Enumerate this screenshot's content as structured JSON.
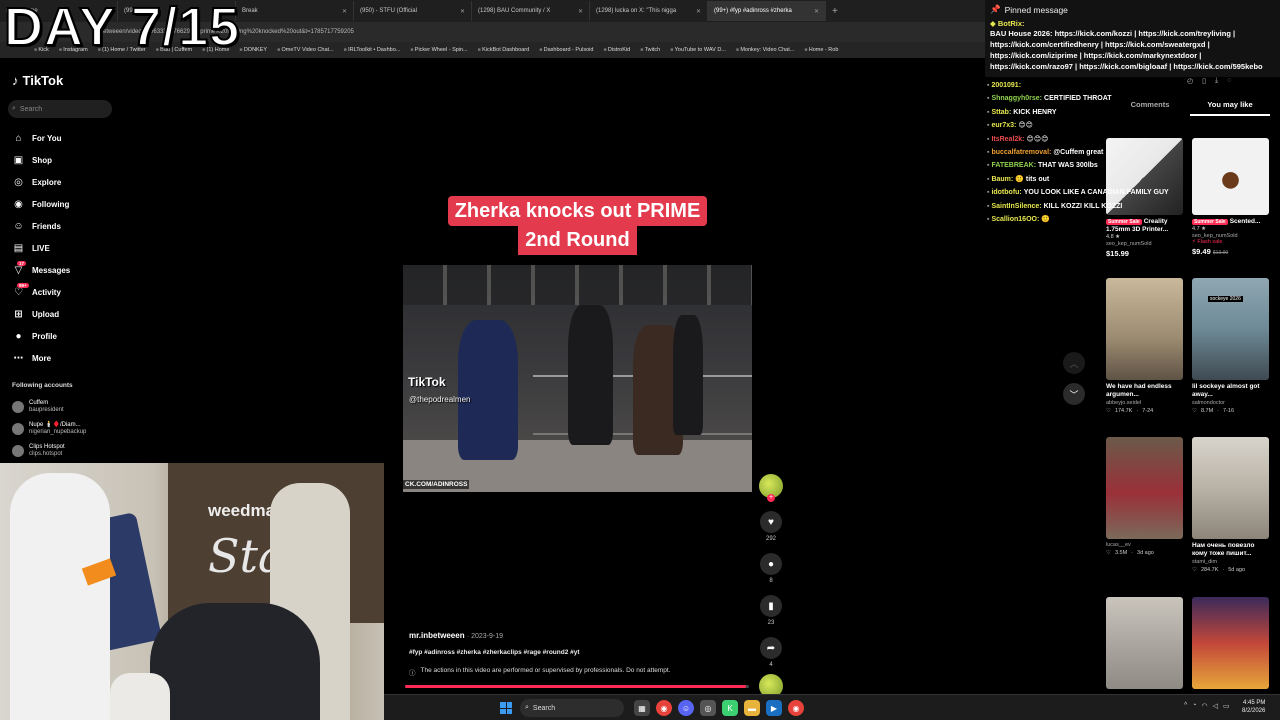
{
  "overlay": {
    "day": "DAY 7/15"
  },
  "browser": {
    "tabs": [
      {
        "label": "(272) Home"
      },
      {
        "label": "(99+)"
      },
      {
        "label": "Break"
      },
      {
        "label": "(950) - STFU (Official"
      },
      {
        "label": "(1298) BAU Community / X"
      },
      {
        "label": "(1298) lucka on X: \"This nigga"
      },
      {
        "label": "(99+) #fyp #adinross #zherka"
      }
    ],
    "url": "inbetweeen/video/73063337976629?q=prime%20fighting%20knocked%20out&t=1785717759205",
    "bookmarks": [
      "Kick",
      "Instagram",
      "(1) Home / Twitter",
      "Bau | Cuffem",
      "(1) Home",
      "DONKEY",
      "OmeTV Video Chat...",
      "IRLToolkit • Dashbo...",
      "Picker Wheel - Spin...",
      "KickBot Dashboard",
      "Dashboard - Pulsoid",
      "DistroKid",
      "Twitch",
      "YouTube to WAV D...",
      "Monkey: Video Chat...",
      "Home - Rob"
    ]
  },
  "tiktok": {
    "logo": "TikTok",
    "search_placeholder": "Search",
    "nav": [
      {
        "label": "For You",
        "icon": "home-icon"
      },
      {
        "label": "Shop",
        "icon": "shop-icon"
      },
      {
        "label": "Explore",
        "icon": "compass-icon"
      },
      {
        "label": "Following",
        "icon": "following-icon"
      },
      {
        "label": "Friends",
        "icon": "friends-icon"
      },
      {
        "label": "LIVE",
        "icon": "live-icon"
      },
      {
        "label": "Messages",
        "icon": "messages-icon",
        "badge": "17"
      },
      {
        "label": "Activity",
        "icon": "activity-icon",
        "badge": "99+"
      },
      {
        "label": "Upload",
        "icon": "upload-icon"
      },
      {
        "label": "Profile",
        "icon": "profile-icon"
      },
      {
        "label": "More",
        "icon": "more-icon"
      }
    ],
    "following_title": "Following accounts",
    "following": [
      {
        "name": "Cuffem",
        "handle": "baupresident"
      },
      {
        "name": "Nupe 🕯️♦️/Diam...",
        "handle": "nigerian_nupebackup"
      },
      {
        "name": "Clips Hotspot",
        "handle": "clips.hotspot"
      }
    ]
  },
  "webcam": {
    "sign_top": "weedmaps",
    "sign_main": "Sta"
  },
  "video": {
    "title_line1": "Zherka knocks out PRIME",
    "title_line2": "2nd Round",
    "watermark": "TikTok",
    "watermark_user": "@thepodrealmen",
    "url_overlay": "CK.COM/ADINROSS",
    "author": "mr.inbetweeen",
    "date": "2023-9-19",
    "hashtags": "#fyp #adinross #zherka #zherkaclips #rage #round2 #yt",
    "warning": "The actions in this video are performed or supervised by professionals. Do not attempt.",
    "progress": 0.99,
    "likes": "292",
    "comments": "8",
    "saves": "23",
    "shares": "4"
  },
  "chat": {
    "pinned_title": "Pinned message",
    "pinned_user": "BotRix:",
    "pinned_text": "BAU House 2026: https://kick.com/kozzi | https://kick.com/treyliving | https://kick.com/certifiedhenry | https://kick.com/sweatergxd | https://kick.com/iziprime | https://kick.com/markynextdoor | https://kick.com/razo97 | https://kick.com/bigloaaf | https://kick.com/595kebo",
    "messages": [
      {
        "user": "2001091:",
        "text": "",
        "color": "#e7e750"
      },
      {
        "user": "Shnaggyh0rse:",
        "text": "CERTIFIED THROAT GOAT",
        "color": "#8fd14f"
      },
      {
        "user": "Sttab:",
        "text": "KICK HENRY",
        "color": "#e7e750"
      },
      {
        "user": "eur7x3:",
        "text": "😊😊",
        "color": "#e7e750"
      },
      {
        "user": "ItsReal2k:",
        "text": "😊😊😊",
        "color": "#e84a4a"
      },
      {
        "user": "buccalfatremoval:",
        "text": "@Cuffem great",
        "color": "#f0a030"
      },
      {
        "user": "FATEBREAK:",
        "text": "THAT WAS 300lbs",
        "color": "#8fd14f"
      },
      {
        "user": "Baum:",
        "text": "🙂 tits out",
        "color": "#e7e750"
      },
      {
        "user": "idotbofu:",
        "text": "YOU LOOK LIKE A CANADIAN FAMILY GUY",
        "color": "#e7e750"
      },
      {
        "user": "SaintInSilence:",
        "text": "KILL KOZZI KILL KOZZI",
        "color": "#e7e750"
      },
      {
        "user": "Scallion16OO:",
        "text": "🙂",
        "color": "#e7e750"
      }
    ]
  },
  "panel": {
    "tab_comments": "Comments",
    "tab_you_may_like": "You may like",
    "products": [
      {
        "badge": "Summer Sale",
        "title": "Creality 1.75mm 3D Printer...",
        "rating": "4.8 ★",
        "seller": "seo_kep_numSold",
        "price": "$15.99",
        "old_price": "",
        "flash": ""
      },
      {
        "badge": "Summer Sale",
        "title": "Scented...",
        "rating": "4.7 ★",
        "seller": "seo_kep_numSold",
        "price": "$9.49",
        "old_price": "$13.99",
        "flash": "⚡ Flash sale"
      }
    ],
    "videos": [
      {
        "title": "We have had endless argumen...",
        "user": "abbeyjo.seidel",
        "likes": "174.7K",
        "date": "7-24"
      },
      {
        "title": "lil sockeye almost got away...",
        "user": "salmondoctor",
        "likes": "8.7M",
        "date": "7-16"
      },
      {
        "title": "",
        "user": "lucas__ev",
        "likes": "3.5M",
        "date": "3d ago"
      },
      {
        "title": "Нам очень повезло кому тоже пишит...",
        "user": "stami_dim",
        "likes": "284.7K",
        "date": "5d ago"
      }
    ],
    "thumb_label": "sockeye 2026"
  },
  "taskbar": {
    "search": "Search",
    "time": "4:45 PM",
    "date": "8/2/2026"
  }
}
